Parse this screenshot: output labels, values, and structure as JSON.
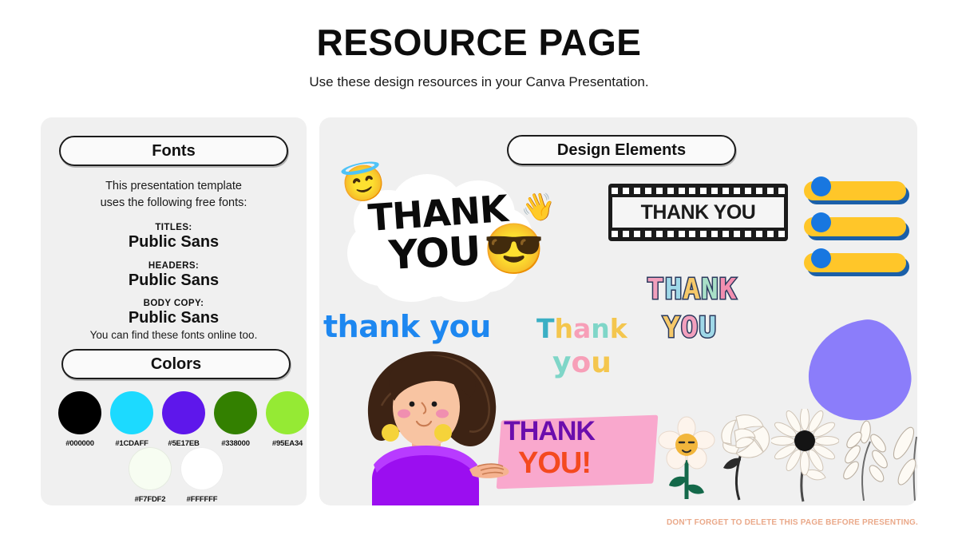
{
  "header": {
    "title": "RESOURCE PAGE",
    "subtitle": "Use these design resources in your Canva Presentation."
  },
  "fonts_panel": {
    "pill_label": "Fonts",
    "intro_line_1": "This presentation template",
    "intro_line_2": "uses the following free fonts:",
    "entries": [
      {
        "label": "TITLES:",
        "value": "Public Sans"
      },
      {
        "label": "HEADERS:",
        "value": "Public Sans"
      },
      {
        "label": "BODY COPY:",
        "value": "Public Sans"
      }
    ],
    "outro": "You can find these fonts online too."
  },
  "colors_panel": {
    "pill_label": "Colors",
    "row_1": [
      {
        "hex": "#000000",
        "label": "#000000"
      },
      {
        "hex": "#1CDAFF",
        "label": "#1CDAFF"
      },
      {
        "hex": "#5E17EB",
        "label": "#5E17EB"
      },
      {
        "hex": "#338000",
        "label": "#338000"
      },
      {
        "hex": "#95EA34",
        "label": "#95EA34"
      }
    ],
    "row_2": [
      {
        "hex": "#F7FDF2",
        "label": "#F7FDF2"
      },
      {
        "hex": "#FFFFFF",
        "label": "#FFFFFF"
      }
    ]
  },
  "elements_panel": {
    "pill_label": "Design Elements",
    "cloud_sticker": {
      "line_1": "THANK",
      "line_2": "YOU"
    },
    "emojis": {
      "angel": "😇",
      "wave": "👋",
      "cool": "😎"
    },
    "film_strip": {
      "text": "THANK YOU"
    },
    "bars": [
      {
        "dot_color": "#1877E0",
        "fill_color": "#FFC629"
      },
      {
        "dot_color": "#1877E0",
        "fill_color": "#FFC629"
      },
      {
        "dot_color": "#1877E0",
        "fill_color": "#FFC629"
      }
    ],
    "pixel_sticker": {
      "line_1": "THANK",
      "line_2": "YOU"
    },
    "blob": {
      "color": "#8B7DFA"
    },
    "script_sticker": {
      "text": "thank you",
      "color": "#1D87F0"
    },
    "pastel_sticker": {
      "line_1": "Thank",
      "line_2": "you",
      "line_1_colors": [
        "#3BAFC4",
        "#F4C64E",
        "#F79FB8",
        "#7FD6C8",
        "#F4C64E"
      ],
      "line_2_colors": [
        "#7FD6C8",
        "#F79FB8",
        "#F4C64E"
      ]
    },
    "banner_sticker": {
      "line_1": "THANK",
      "line_2": "YOU!",
      "line_1_color": "#6A0DAD",
      "line_2_color": "#F4491F",
      "banner_color": "#F9A8CD"
    },
    "botanicals": [
      "smiley-daisy-flower",
      "rose-flower",
      "black-center-daisy",
      "leaf-sprig",
      "leaf-sprig"
    ]
  },
  "footer": {
    "note": "DON'T FORGET TO DELETE THIS PAGE BEFORE PRESENTING."
  }
}
